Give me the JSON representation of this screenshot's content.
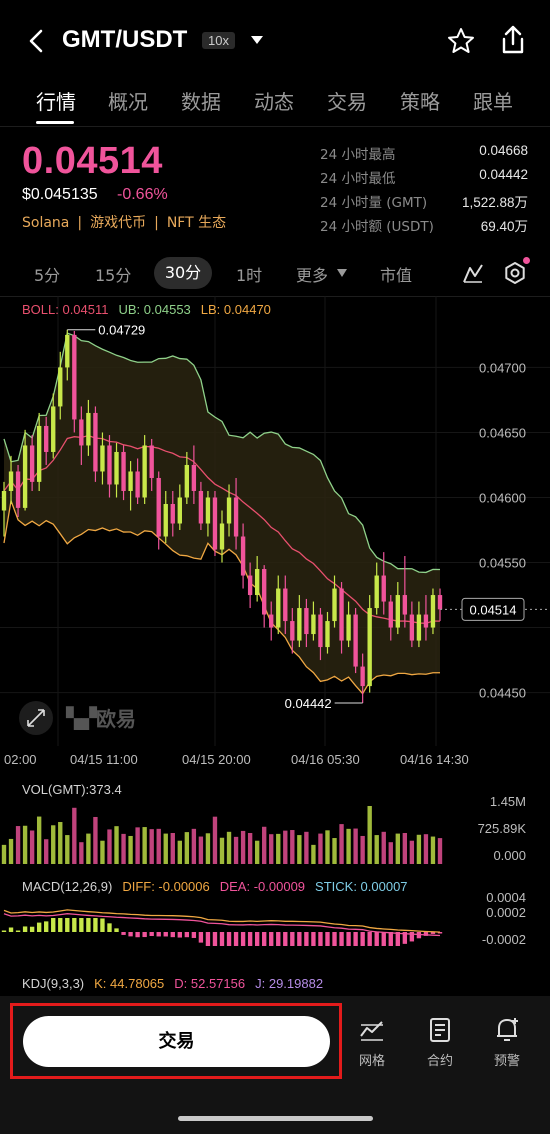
{
  "header": {
    "back_icon": "chevron-left-icon",
    "pair": "GMT/USDT",
    "leverage": "10x",
    "dropdown_icon": "caret-down-icon",
    "favorite_icon": "star-outline-icon",
    "share_icon": "share-icon"
  },
  "tabs": [
    {
      "label": "行情",
      "active": true
    },
    {
      "label": "概况"
    },
    {
      "label": "数据"
    },
    {
      "label": "动态"
    },
    {
      "label": "交易"
    },
    {
      "label": "策略"
    },
    {
      "label": "跟单"
    }
  ],
  "ticker": {
    "price": "0.04514",
    "usd_price": "$0.045135",
    "change": "-0.66%",
    "tags": [
      "Solana",
      "游戏代币",
      "NFT 生态"
    ]
  },
  "stats": [
    {
      "label": "24 小时最高",
      "value": "0.04668"
    },
    {
      "label": "24 小时最低",
      "value": "0.04442"
    },
    {
      "label": "24 小时量 (GMT)",
      "value": "1,522.88万"
    },
    {
      "label": "24 小时额 (USDT)",
      "value": "69.40万"
    }
  ],
  "timeframes": {
    "items": [
      "5分",
      "15分",
      "30分",
      "1时",
      "更多",
      "市值"
    ],
    "active": "30分"
  },
  "boll": {
    "label": "BOLL: 0.04511",
    "ub": "UB: 0.04553",
    "lb": "LB: 0.04470"
  },
  "colors": {
    "up": "#c8e84a",
    "down": "#f0549b",
    "mid": "#e8506e",
    "upper": "#8fd18a",
    "lower": "#f0a843",
    "brand_pink": "#f0549b",
    "tag": "#e7a95b"
  },
  "chart_data": {
    "type": "candlestick",
    "y_ticks": [
      "0.04700",
      "0.04650",
      "0.04600",
      "0.04550",
      "0.04450"
    ],
    "ylim": [
      0.04432,
      0.04738
    ],
    "x_ticks": [
      "02:00",
      "04/15 11:00",
      "04/15 20:00",
      "04/16 05:30",
      "04/16 14:30"
    ],
    "current_price_label": "0.04514",
    "high_marker": "0.04729",
    "low_marker": "0.04442",
    "watermark": "欧易",
    "candles": [
      [
        0.0459,
        0.04605,
        0.0457,
        0.04612
      ],
      [
        0.04605,
        0.0462,
        0.04595,
        0.04632
      ],
      [
        0.0462,
        0.04592,
        0.04585,
        0.04625
      ],
      [
        0.04592,
        0.0464,
        0.0459,
        0.04652
      ],
      [
        0.0464,
        0.04612,
        0.04605,
        0.04648
      ],
      [
        0.04612,
        0.04655,
        0.04605,
        0.04665
      ],
      [
        0.04655,
        0.04635,
        0.04625,
        0.04662
      ],
      [
        0.04635,
        0.0467,
        0.0463,
        0.0468
      ],
      [
        0.0467,
        0.047,
        0.0466,
        0.04712
      ],
      [
        0.047,
        0.04725,
        0.0469,
        0.04729
      ],
      [
        0.04725,
        0.0466,
        0.0465,
        0.04728
      ],
      [
        0.0466,
        0.0464,
        0.04625,
        0.0467
      ],
      [
        0.0464,
        0.04665,
        0.04632,
        0.04675
      ],
      [
        0.04665,
        0.0462,
        0.04612,
        0.0467
      ],
      [
        0.0462,
        0.0464,
        0.0461,
        0.0465
      ],
      [
        0.0464,
        0.0461,
        0.046,
        0.04648
      ],
      [
        0.0461,
        0.04635,
        0.046,
        0.04642
      ],
      [
        0.04635,
        0.04605,
        0.04598,
        0.0464
      ],
      [
        0.04605,
        0.0462,
        0.0459,
        0.04628
      ],
      [
        0.0462,
        0.046,
        0.04595,
        0.0463
      ],
      [
        0.046,
        0.0464,
        0.04595,
        0.04648
      ],
      [
        0.0464,
        0.04615,
        0.04605,
        0.04645
      ],
      [
        0.04615,
        0.0457,
        0.0456,
        0.0462
      ],
      [
        0.0457,
        0.04595,
        0.04565,
        0.04605
      ],
      [
        0.04595,
        0.0458,
        0.0457,
        0.04605
      ],
      [
        0.0458,
        0.046,
        0.04575,
        0.0461
      ],
      [
        0.046,
        0.04625,
        0.04595,
        0.04635
      ],
      [
        0.04625,
        0.04605,
        0.04595,
        0.0464
      ],
      [
        0.04605,
        0.0458,
        0.04575,
        0.04612
      ],
      [
        0.0458,
        0.046,
        0.0457,
        0.04605
      ],
      [
        0.046,
        0.0456,
        0.04555,
        0.04605
      ],
      [
        0.0456,
        0.0458,
        0.0455,
        0.0459
      ],
      [
        0.0458,
        0.046,
        0.0457,
        0.0461
      ],
      [
        0.046,
        0.0457,
        0.0456,
        0.04615
      ],
      [
        0.0457,
        0.0454,
        0.0453,
        0.0458
      ],
      [
        0.0454,
        0.04525,
        0.04515,
        0.0455
      ],
      [
        0.04525,
        0.04545,
        0.0452,
        0.04555
      ],
      [
        0.04545,
        0.0451,
        0.045,
        0.04548
      ],
      [
        0.0451,
        0.045,
        0.0449,
        0.0452
      ],
      [
        0.045,
        0.0453,
        0.04495,
        0.0454
      ],
      [
        0.0453,
        0.04505,
        0.04495,
        0.0454
      ],
      [
        0.04505,
        0.0449,
        0.0448,
        0.04515
      ],
      [
        0.0449,
        0.04515,
        0.04485,
        0.04525
      ],
      [
        0.04515,
        0.04495,
        0.04485,
        0.04522
      ],
      [
        0.04495,
        0.0451,
        0.0449,
        0.0452
      ],
      [
        0.0451,
        0.04485,
        0.04475,
        0.04515
      ],
      [
        0.04485,
        0.04505,
        0.0448,
        0.04512
      ],
      [
        0.04505,
        0.0453,
        0.045,
        0.0454
      ],
      [
        0.0453,
        0.0449,
        0.0448,
        0.04535
      ],
      [
        0.0449,
        0.0451,
        0.04485,
        0.0452
      ],
      [
        0.0451,
        0.0447,
        0.04465,
        0.04515
      ],
      [
        0.0447,
        0.04455,
        0.04442,
        0.0448
      ],
      [
        0.04455,
        0.04515,
        0.0445,
        0.04525
      ],
      [
        0.04515,
        0.0454,
        0.0451,
        0.0455
      ],
      [
        0.0454,
        0.0452,
        0.0451,
        0.04558
      ],
      [
        0.0452,
        0.045,
        0.0449,
        0.04525
      ],
      [
        0.045,
        0.04525,
        0.04495,
        0.04535
      ],
      [
        0.04525,
        0.0451,
        0.045,
        0.04555
      ],
      [
        0.0451,
        0.0449,
        0.04485,
        0.0452
      ],
      [
        0.0449,
        0.0451,
        0.04485,
        0.0452
      ],
      [
        0.0451,
        0.045,
        0.0449,
        0.04525
      ],
      [
        0.045,
        0.04525,
        0.04495,
        0.0453
      ],
      [
        0.04525,
        0.04514,
        0.04505,
        0.0453
      ]
    ],
    "volume": {
      "label": "VOL(GMT):373.4",
      "y_ticks": [
        "1.45M",
        "725.89K",
        "0.000"
      ]
    },
    "macd": {
      "label": "MACD(12,26,9)",
      "diff": "DIFF: -0.00006",
      "dea": "DEA: -0.00009",
      "stick": "STICK: 0.00007",
      "y_ticks": [
        "0.0004",
        "0.0002",
        "-0.0002"
      ]
    },
    "kdj": {
      "label": "KDJ(9,3,3)",
      "k": "K: 44.78065",
      "d": "D: 52.57156",
      "j": "J: 29.19882"
    }
  },
  "bottom_bar": {
    "trade_label": "交易",
    "items": [
      {
        "label": "网格",
        "icon": "grid-trading-icon"
      },
      {
        "label": "合约",
        "icon": "contract-icon"
      },
      {
        "label": "预警",
        "icon": "bell-alert-icon"
      }
    ]
  }
}
